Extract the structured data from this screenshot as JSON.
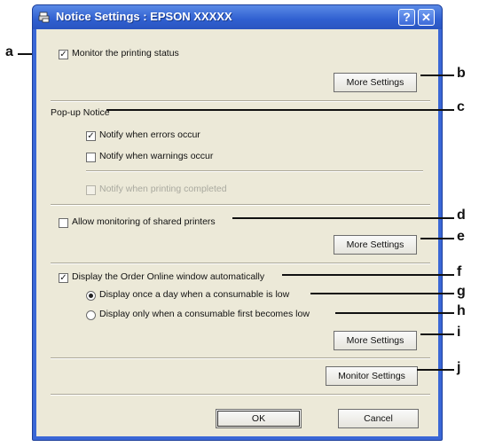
{
  "window": {
    "title": "Notice Settings : EPSON XXXXX",
    "help_glyph": "?",
    "close_glyph": "✕"
  },
  "monitor": {
    "label": "Monitor the printing status",
    "checked": true
  },
  "more_settings_1": "More Settings",
  "popup": {
    "heading": "Pop-up Notice",
    "errors": {
      "label": "Notify when errors occur",
      "checked": true
    },
    "warnings": {
      "label": "Notify when warnings occur",
      "checked": false
    },
    "completed": {
      "label": "Notify when printing completed",
      "checked": false,
      "disabled": true
    }
  },
  "shared": {
    "label": "Allow monitoring of shared printers",
    "checked": false
  },
  "more_settings_2": "More Settings",
  "order_online": {
    "label": "Display the Order Online window automatically",
    "checked": true,
    "option_once_day": "Display once a day when a consumable is low",
    "option_first_low": "Display only when a consumable first becomes low",
    "selected": "once_day"
  },
  "more_settings_3": "More Settings",
  "monitor_settings": "Monitor Settings",
  "ok": "OK",
  "cancel": "Cancel",
  "callouts": {
    "a": "a",
    "b": "b",
    "c": "c",
    "d": "d",
    "e": "e",
    "f": "f",
    "g": "g",
    "h": "h",
    "i": "i",
    "j": "j"
  },
  "colors": {
    "titlebar": "#2f5fd0",
    "dialog_bg": "#ece9d8"
  }
}
